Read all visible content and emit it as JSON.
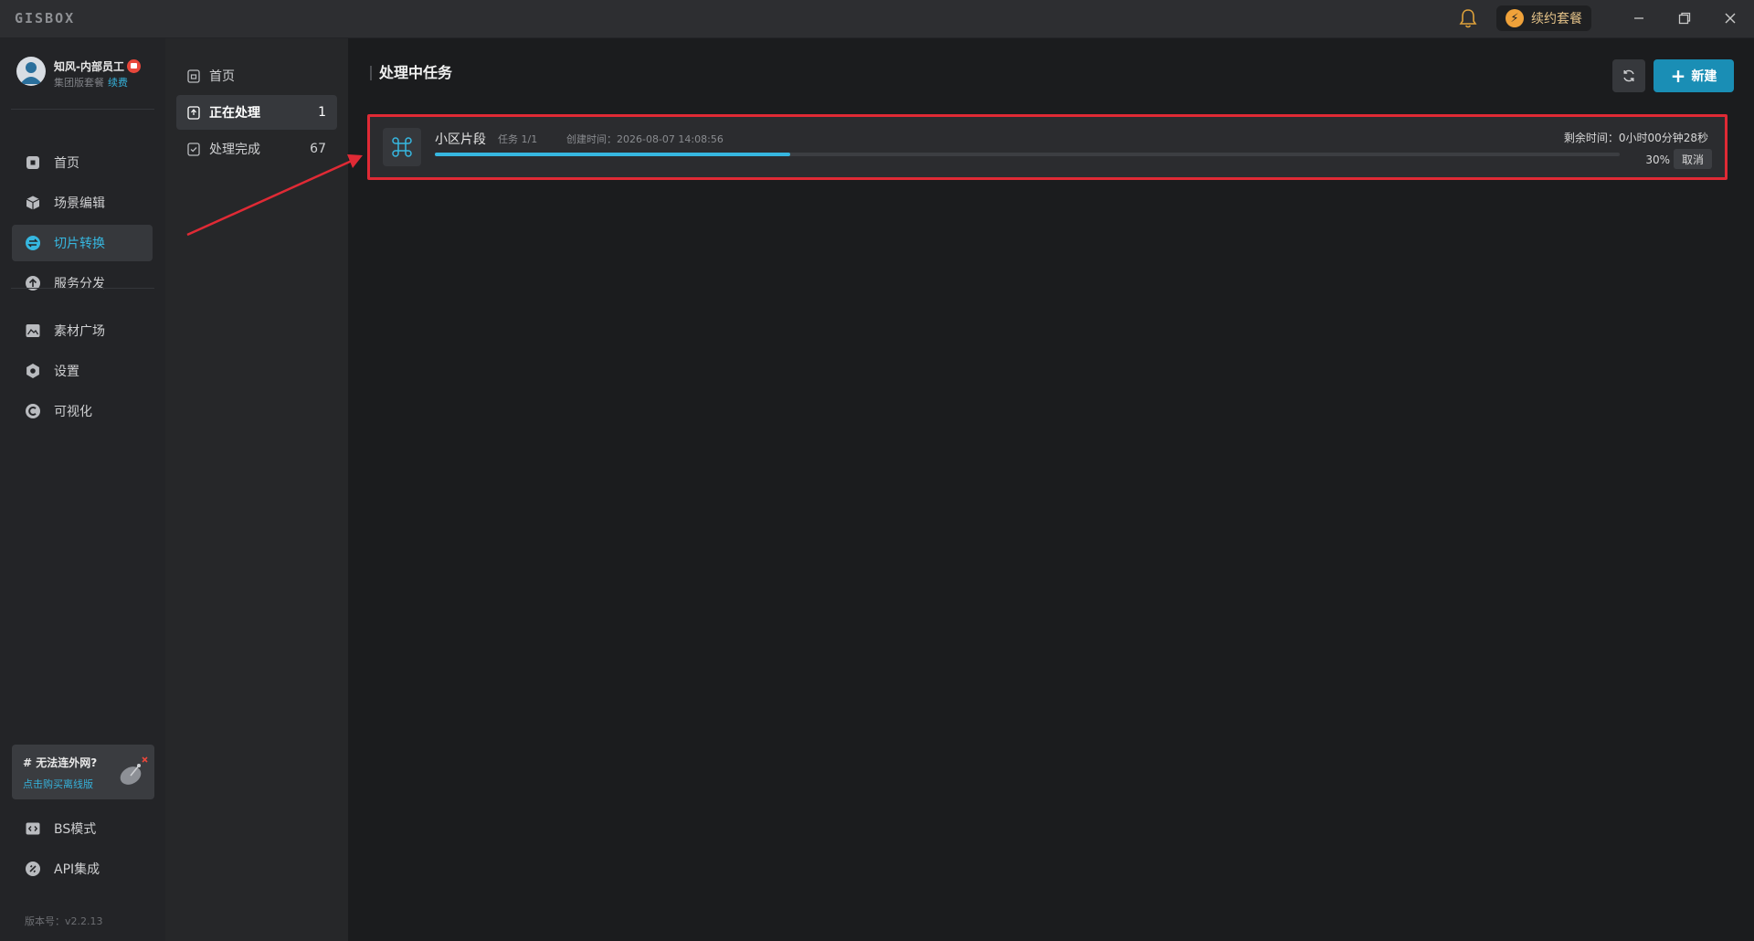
{
  "app": {
    "logo": "GISBOX",
    "renew_label": "续约套餐"
  },
  "user": {
    "name": "知风-内部员工",
    "plan": "集团版套餐",
    "renew_link": "续费"
  },
  "sidebar": {
    "items": [
      {
        "label": "首页",
        "icon": "home-icon"
      },
      {
        "label": "场景编辑",
        "icon": "cube-icon"
      },
      {
        "label": "切片转换",
        "icon": "swap-icon",
        "active": true
      },
      {
        "label": "服务分发",
        "icon": "upload-icon"
      },
      {
        "label": "素材广场",
        "icon": "image-icon"
      },
      {
        "label": "设置",
        "icon": "gear-icon"
      },
      {
        "label": "可视化",
        "icon": "c-icon"
      },
      {
        "label": "BS模式",
        "icon": "code-icon"
      },
      {
        "label": "API集成",
        "icon": "api-icon"
      }
    ],
    "promo": {
      "title": "# 无法连外网?",
      "link": "点击购买离线版"
    },
    "version": "版本号：v2.2.13"
  },
  "subnav": {
    "items": [
      {
        "label": "首页",
        "count": ""
      },
      {
        "label": "正在处理",
        "count": "1",
        "active": true
      },
      {
        "label": "处理完成",
        "count": "67"
      }
    ]
  },
  "main": {
    "title": "处理中任务",
    "new_button": "新建",
    "tasks": [
      {
        "name": "小区片段",
        "count": "任务 1/1",
        "created": "创建时间：2026-08-07 14:08:56",
        "remaining": "剩余时间：0小时00分钟28秒",
        "progress": 30,
        "progress_label": "30%",
        "cancel": "取消"
      }
    ]
  },
  "colors": {
    "accent": "#36b7e0",
    "primary_button": "#1a8eb5",
    "highlight_border": "#e02a35",
    "annotation_arrow": "#e02a35"
  }
}
